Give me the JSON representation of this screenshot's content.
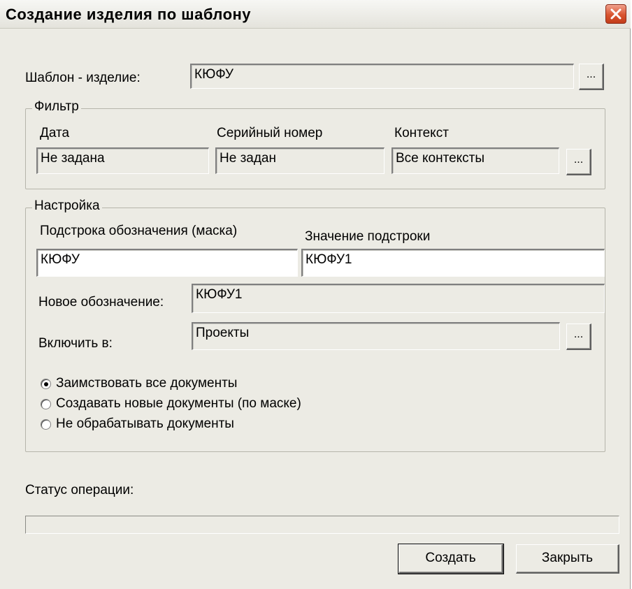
{
  "window": {
    "title": "Создание изделия по шаблону"
  },
  "template": {
    "label": "Шаблон - изделие:",
    "value": "КЮФУ",
    "browse_label": "..."
  },
  "filter": {
    "title": "Фильтр",
    "date_label": "Дата",
    "date_value": "Не задана",
    "serial_label": "Серийный номер",
    "serial_value": "Не задан",
    "context_label": "Контекст",
    "context_value": "Все контексты",
    "context_browse_label": "..."
  },
  "settings": {
    "title": "Настройка",
    "mask_label": "Подстрока обозначения (маска)",
    "mask_value": "КЮФУ",
    "substring_label": "Значение подстроки",
    "substring_value": "КЮФУ1",
    "new_designation_label": "Новое обозначение:",
    "new_designation_value": "КЮФУ1",
    "include_label": "Включить в:",
    "include_value": "Проекты",
    "include_browse_label": "...",
    "options": [
      {
        "label": "Заимствовать все документы",
        "selected": true
      },
      {
        "label": "Создавать новые документы (по маске)",
        "selected": false
      },
      {
        "label": "Не обрабатывать документы",
        "selected": false
      }
    ]
  },
  "status": {
    "label": "Статус операции:",
    "progress": 0
  },
  "buttons": {
    "create": "Создать",
    "close": "Закрыть"
  },
  "colors": {
    "dialog_bg": "#ecebe4",
    "close_button": "#d9542f"
  }
}
